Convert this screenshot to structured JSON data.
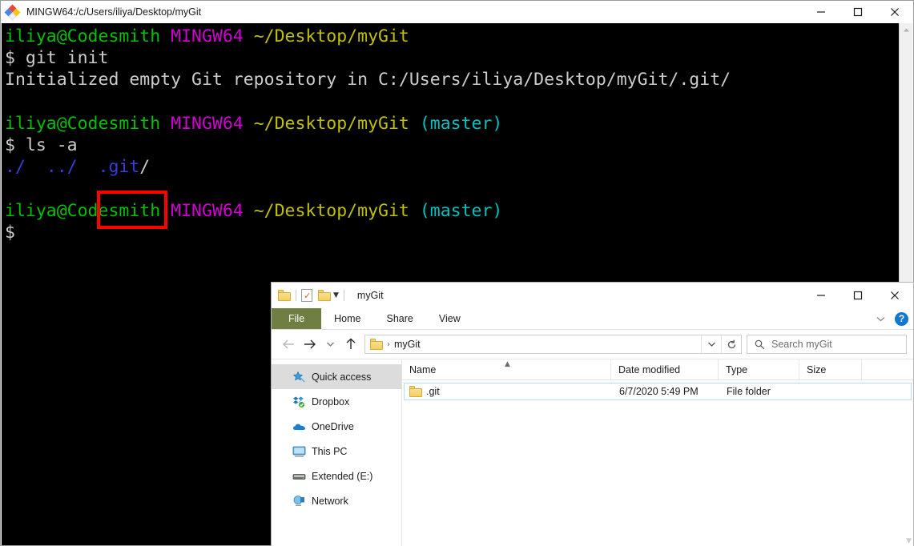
{
  "terminal": {
    "title": "MINGW64:/c/Users/iliya/Desktop/myGit",
    "app_icon": "git-bash-icon",
    "background": "#000000",
    "colors": {
      "user_host": "#00c000",
      "shell": "#d000d0",
      "path": "#c0c000",
      "branch": "#00c0c0",
      "directory": "#3b3bd6",
      "default_text": "#cccccc"
    },
    "window_controls": {
      "minimize": "minimize-icon",
      "maximize": "maximize-icon",
      "close": "close-icon"
    },
    "lines": [
      {
        "type": "prompt",
        "user_host": "iliya@Codesmith",
        "shell": "MINGW64",
        "path": "~/Desktop/myGit",
        "branch": ""
      },
      {
        "type": "command",
        "prompt": "$",
        "text": " git init"
      },
      {
        "type": "output",
        "text": "Initialized empty Git repository in C:/Users/iliya/Desktop/myGit/.git/"
      },
      {
        "type": "blank",
        "text": ""
      },
      {
        "type": "prompt",
        "user_host": "iliya@Codesmith",
        "shell": "MINGW64",
        "path": "~/Desktop/myGit",
        "branch": "(master)"
      },
      {
        "type": "command",
        "prompt": "$",
        "text": " ls -a"
      },
      {
        "type": "listing",
        "entries": [
          "./",
          "../",
          ".git/"
        ]
      },
      {
        "type": "blank",
        "text": ""
      },
      {
        "type": "prompt",
        "user_host": "iliya@Codesmith",
        "shell": "MINGW64",
        "path": "~/Desktop/myGit",
        "branch": "(master)"
      },
      {
        "type": "command",
        "prompt": "$",
        "text": ""
      }
    ],
    "rendered": {
      "l1_user": "iliya@Codesmith",
      "l1_shell": "MINGW64",
      "l1_path": "~/Desktop/myGit",
      "l2": "$ git init",
      "l3": "Initialized empty Git repository in C:/Users/iliya/Desktop/myGit/.git/",
      "l5_user": "iliya@Codesmith",
      "l5_shell": "MINGW64",
      "l5_path": "~/Desktop/myGit",
      "l5_branch": "(master)",
      "l6": "$ ls -a",
      "l7_dot": "./",
      "l7_dotdot": "../",
      "l7_git": ".git",
      "l7_slash": "/",
      "l9_user": "iliya@Codesmith",
      "l9_shell": "MINGW64",
      "l9_path": "~/Desktop/myGit",
      "l9_branch": "(master)",
      "l10": "$"
    },
    "annotation": {
      "name": "red-highlight-box",
      "target": ".git/",
      "color": "#ff0000"
    }
  },
  "explorer": {
    "title": "myGit",
    "quick_access_toolbar": {
      "folder_icon": "folder-icon",
      "properties_icon": "properties-checklist-icon",
      "new_folder_icon": "new-folder-icon",
      "customize_icon": "chevron-down-icon"
    },
    "window_controls": {
      "minimize": "minimize-icon",
      "maximize": "maximize-icon",
      "close": "close-icon"
    },
    "ribbon": {
      "tabs": [
        {
          "label": "File",
          "active": true,
          "color": "#6f7f42"
        },
        {
          "label": "Home",
          "active": false
        },
        {
          "label": "Share",
          "active": false
        },
        {
          "label": "View",
          "active": false
        }
      ],
      "collapse_icon": "chevron-down-icon",
      "help_label": "?"
    },
    "navigation": {
      "back_icon": "arrow-left-icon",
      "forward_icon": "arrow-right-icon",
      "recent_icon": "chevron-down-icon",
      "up_icon": "arrow-up-icon",
      "address_folder_icon": "folder-icon",
      "address_separator": "›",
      "address_text": "myGit",
      "address_dropdown_icon": "chevron-down-icon",
      "refresh_icon": "refresh-icon",
      "search_icon": "search-icon",
      "search_placeholder": "Search myGit",
      "search_value": ""
    },
    "sidebar": {
      "items": [
        {
          "label": "Quick access",
          "icon": "star-pin-icon",
          "selected": true
        },
        {
          "label": "Dropbox",
          "icon": "dropbox-icon",
          "selected": false
        },
        {
          "label": "OneDrive",
          "icon": "onedrive-cloud-icon",
          "selected": false
        },
        {
          "label": "This PC",
          "icon": "monitor-icon",
          "selected": false
        },
        {
          "label": "Extended (E:)",
          "icon": "hard-drive-icon",
          "selected": false
        },
        {
          "label": "Network",
          "icon": "network-icon",
          "selected": false
        }
      ]
    },
    "file_list": {
      "columns": [
        "Name",
        "Date modified",
        "Type",
        "Size"
      ],
      "sort_column": "Name",
      "sort_direction": "ascending",
      "sort_icon": "caret-up-icon",
      "rows": [
        {
          "icon": "folder-icon",
          "name": ".git",
          "date_modified": "6/7/2020 5:49 PM",
          "type": "File folder",
          "size": ""
        }
      ]
    }
  }
}
